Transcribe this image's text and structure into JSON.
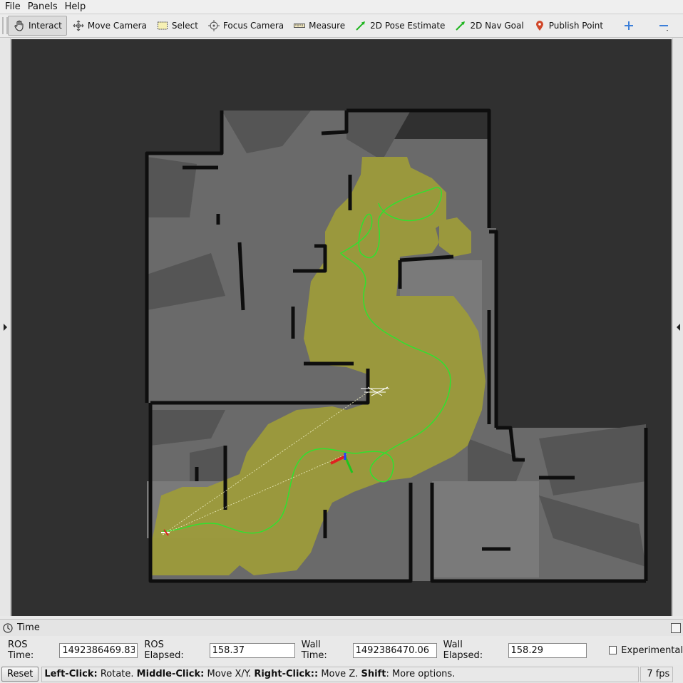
{
  "menu": {
    "file": "File",
    "panels": "Panels",
    "help": "Help"
  },
  "toolbar": {
    "tools": [
      {
        "label": "Interact",
        "icon": "hand-icon"
      },
      {
        "label": "Move Camera",
        "icon": "move-camera-icon"
      },
      {
        "label": "Select",
        "icon": "select-icon"
      },
      {
        "label": "Focus Camera",
        "icon": "focus-camera-icon"
      },
      {
        "label": "Measure",
        "icon": "measure-icon"
      },
      {
        "label": "2D Pose Estimate",
        "icon": "pose-estimate-arrow-icon"
      },
      {
        "label": "2D Nav Goal",
        "icon": "nav-goal-arrow-icon"
      },
      {
        "label": "Publish Point",
        "icon": "map-pin-icon"
      }
    ],
    "active_tool": "Interact"
  },
  "time_panel": {
    "title": "Time",
    "ros_time_label": "ROS Time:",
    "ros_time": "1492386469.83",
    "ros_elapsed_label": "ROS Elapsed:",
    "ros_elapsed": "158.37",
    "wall_time_label": "Wall Time:",
    "wall_time": "1492386470.06",
    "wall_elapsed_label": "Wall Elapsed:",
    "wall_elapsed": "158.29",
    "experimental_label": "Experimental"
  },
  "statusbar": {
    "reset_label": "Reset",
    "hint_left_click": "Left-Click:",
    "hint_rotate": " Rotate. ",
    "hint_middle_click": "Middle-Click:",
    "hint_move_xy": " Move X/Y. ",
    "hint_right_click": "Right-Click::",
    "hint_move_z": " Move Z. ",
    "hint_shift": "Shift",
    "hint_more": ": More options.",
    "fps": "7 fps"
  },
  "colors": {
    "viewport_bg": "#303030",
    "map_free": "#6e6e6e",
    "map_unknown": "#4a4a4a",
    "map_wall": "#101010",
    "costmap": "#9c9a3c",
    "path": "#2ee62e"
  }
}
